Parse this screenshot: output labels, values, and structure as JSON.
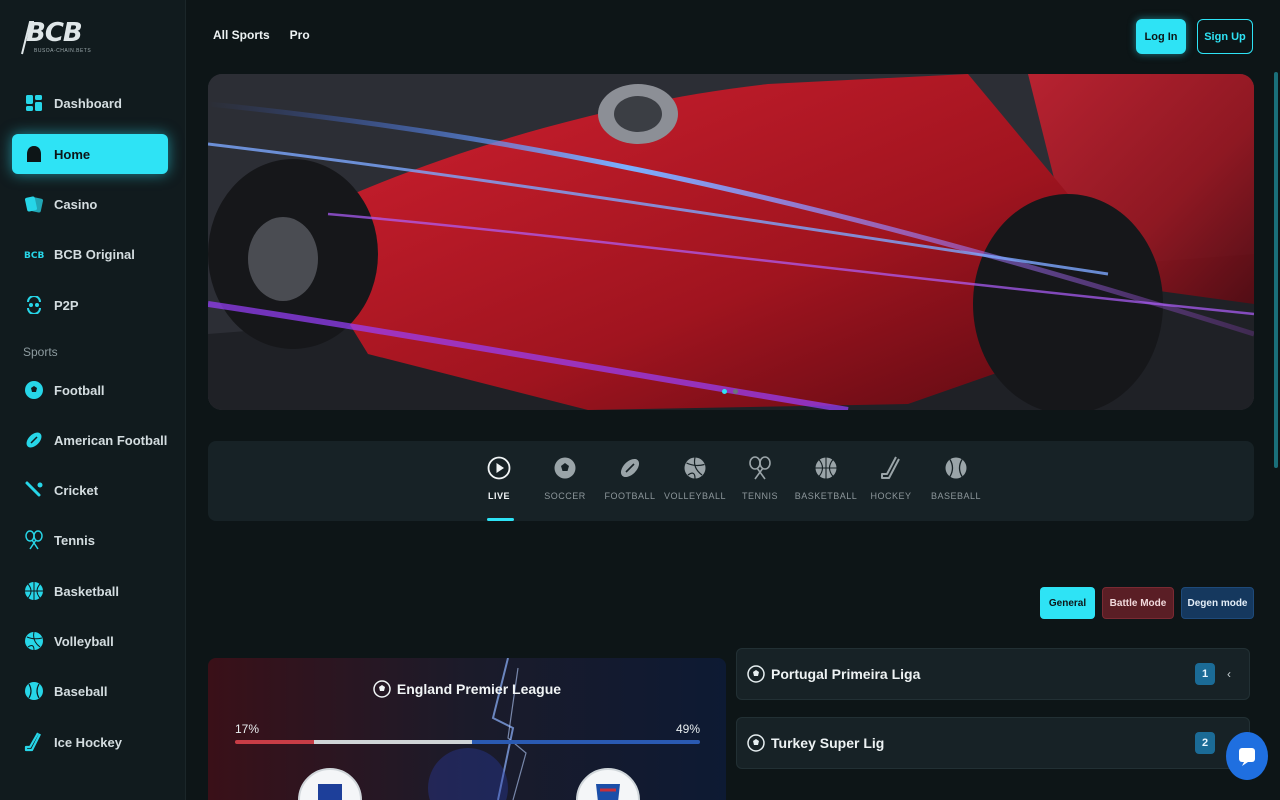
{
  "logo": {
    "text": "BCB",
    "sub": "BUSOA-CHAIN.BETS"
  },
  "sidebar": {
    "items": [
      {
        "label": "Dashboard",
        "icon": "dashboard-icon"
      },
      {
        "label": "Home",
        "icon": "home-icon",
        "active": true
      },
      {
        "label": "Casino",
        "icon": "cards-icon"
      },
      {
        "label": "BCB Original",
        "icon": "bcb-icon"
      },
      {
        "label": "P2P",
        "icon": "p2p-icon"
      }
    ],
    "sports_label": "Sports",
    "sports": [
      {
        "label": "Football",
        "icon": "soccer-ball-icon"
      },
      {
        "label": "American Football",
        "icon": "american-football-icon"
      },
      {
        "label": "Cricket",
        "icon": "cricket-icon"
      },
      {
        "label": "Tennis",
        "icon": "tennis-icon"
      },
      {
        "label": "Basketball",
        "icon": "basketball-icon"
      },
      {
        "label": "Volleyball",
        "icon": "volleyball-icon"
      },
      {
        "label": "Baseball",
        "icon": "baseball-icon"
      },
      {
        "label": "Ice Hockey",
        "icon": "ice-hockey-icon"
      }
    ]
  },
  "header": {
    "nav": [
      "All Sports",
      "Pro"
    ],
    "login_label": "Log In",
    "signup_label": "Sign Up"
  },
  "banner": {
    "slides": 2,
    "active_slide": 1
  },
  "sport_tabs": [
    {
      "label": "LIVE",
      "icon": "play-icon",
      "active": true
    },
    {
      "label": "SOCCER",
      "icon": "soccer-ball-icon"
    },
    {
      "label": "FOOTBALL",
      "icon": "american-football-icon"
    },
    {
      "label": "VOLLEYBALL",
      "icon": "volleyball-icon"
    },
    {
      "label": "TENNIS",
      "icon": "tennis-icon"
    },
    {
      "label": "BASKETBALL",
      "icon": "basketball-icon"
    },
    {
      "label": "HOCKEY",
      "icon": "hockey-icon"
    },
    {
      "label": "BASEBALL",
      "icon": "baseball-icon"
    }
  ],
  "modes": {
    "general": "General",
    "battle": "Battle Mode",
    "degen": "Degen mode"
  },
  "match": {
    "league": "England Premier League",
    "home_pct": "17%",
    "away_pct": "49%",
    "home_prob": 0.17,
    "draw_prob": 0.34,
    "away_prob": 0.49
  },
  "leagues": [
    {
      "name": "Portugal Primeira Liga",
      "count": "1"
    },
    {
      "name": "Turkey Super Lig",
      "count": "2"
    }
  ],
  "colors": {
    "accent": "#2ee3f5",
    "battle": "#5a1e25",
    "degen": "#15385e",
    "count_badge": "#1b6b96"
  }
}
